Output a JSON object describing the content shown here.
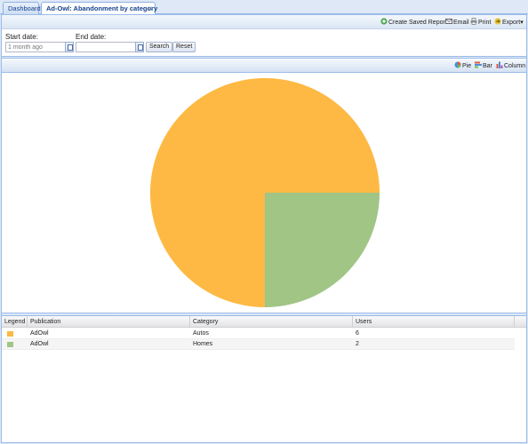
{
  "tabs": [
    {
      "label": "Dashboard",
      "active": false
    },
    {
      "label": "Ad-Owl: Abandonment by category",
      "active": true,
      "close": "×"
    }
  ],
  "toolbar": {
    "create_saved_report": "Create Saved Report",
    "email": "Email",
    "print": "Print",
    "export": "Export",
    "export_arrow": "▾"
  },
  "filters": {
    "start_label": "Start date:",
    "start_value": "1 month ago",
    "end_label": "End date:",
    "end_value": "",
    "search": "Search",
    "reset": "Reset"
  },
  "chart_toolbar": {
    "pie": "Pie",
    "bar": "Bar",
    "column": "Column"
  },
  "colors": {
    "autos": "#fdb943",
    "homes": "#a0c585"
  },
  "chart_data": {
    "type": "pie",
    "categories": [
      "Autos",
      "Homes"
    ],
    "values": [
      6,
      2
    ]
  },
  "grid": {
    "headers": [
      "Legend",
      "Publication",
      "Category",
      "Users"
    ],
    "rows": [
      {
        "publication": "AdOwl",
        "category": "Autos",
        "users": "6",
        "color": "#fdb943"
      },
      {
        "publication": "AdOwl",
        "category": "Homes",
        "users": "2",
        "color": "#a0c585"
      }
    ]
  }
}
